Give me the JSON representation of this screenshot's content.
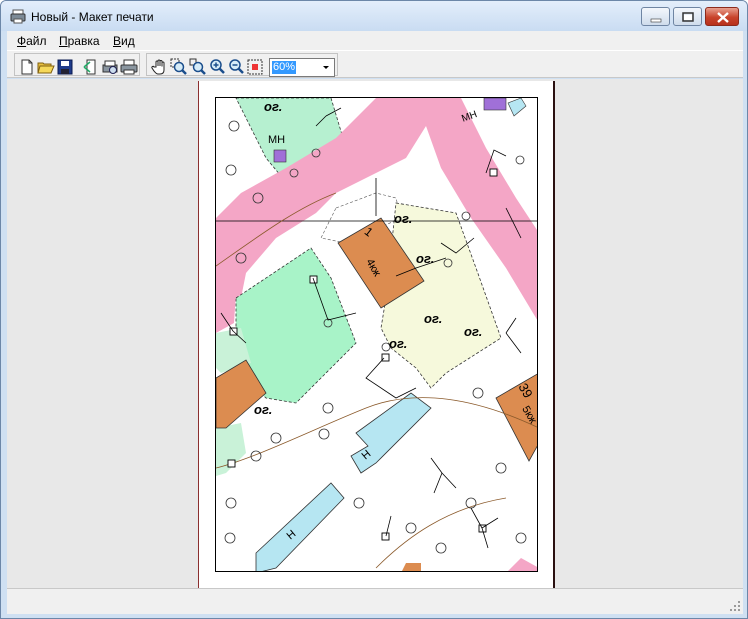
{
  "window": {
    "title": "Новый - Макет печати"
  },
  "menu": {
    "items": [
      {
        "key": "Ф",
        "rest": "айл"
      },
      {
        "key": "П",
        "rest": "равка"
      },
      {
        "key": "В",
        "rest": "ид"
      }
    ]
  },
  "toolbar": {
    "buttons": [
      "new-document-icon",
      "open-folder-icon",
      "save-icon",
      "page-setup-icon",
      "print-preview-icon",
      "print-icon",
      "pan-hand-icon",
      "zoom-in-area-icon",
      "zoom-out-area-icon",
      "zoom-in-icon",
      "zoom-out-icon",
      "fit-page-icon"
    ],
    "zoom_value": "60%"
  },
  "map": {
    "labels": {
      "og1": "ог.",
      "og2": "ог.",
      "og3": "ог.",
      "og4": "ог.",
      "og5": "ог.",
      "og6": "ог.",
      "mn": "МН",
      "mn2": "МН",
      "b1_num": "1",
      "b1_type": "4кж",
      "b2_num": "39",
      "b2_type": "5кж",
      "n1": "Н",
      "n2": "Н"
    }
  },
  "colors": {
    "road": "#f7a8c8",
    "lawn": "#a8f0c8",
    "yard": "#f5fadc",
    "building": "#dc8c50",
    "nonres": "#b4e4f0",
    "purple": "#a070d8"
  }
}
